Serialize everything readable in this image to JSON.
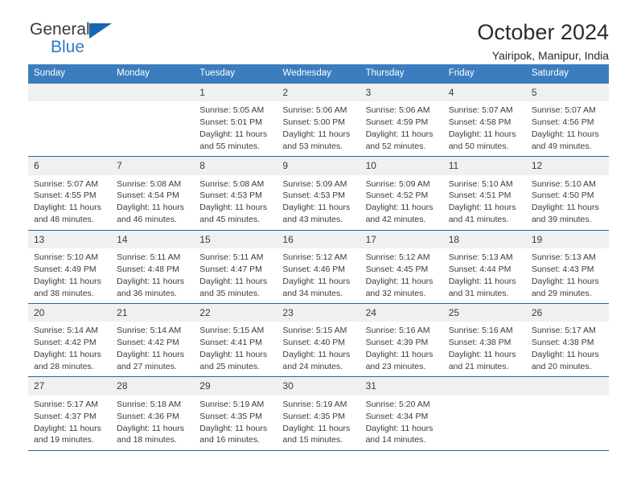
{
  "brand": {
    "name_top": "General",
    "name_bottom": "Blue",
    "triangle_icon": "triangle-icon",
    "accent_color": "#1668b3"
  },
  "header": {
    "title": "October 2024",
    "subtitle": "Yairipok, Manipur, India"
  },
  "calendar": {
    "header_bg": "#3b7dbf",
    "date_band_bg": "#f0f0f0",
    "separator_color": "#1668b3",
    "weekdays": [
      "Sunday",
      "Monday",
      "Tuesday",
      "Wednesday",
      "Thursday",
      "Friday",
      "Saturday"
    ],
    "weeks": [
      [
        {
          "day": "",
          "lines": []
        },
        {
          "day": "",
          "lines": []
        },
        {
          "day": "1",
          "lines": [
            "Sunrise: 5:05 AM",
            "Sunset: 5:01 PM",
            "Daylight: 11 hours",
            "and 55 minutes."
          ]
        },
        {
          "day": "2",
          "lines": [
            "Sunrise: 5:06 AM",
            "Sunset: 5:00 PM",
            "Daylight: 11 hours",
            "and 53 minutes."
          ]
        },
        {
          "day": "3",
          "lines": [
            "Sunrise: 5:06 AM",
            "Sunset: 4:59 PM",
            "Daylight: 11 hours",
            "and 52 minutes."
          ]
        },
        {
          "day": "4",
          "lines": [
            "Sunrise: 5:07 AM",
            "Sunset: 4:58 PM",
            "Daylight: 11 hours",
            "and 50 minutes."
          ]
        },
        {
          "day": "5",
          "lines": [
            "Sunrise: 5:07 AM",
            "Sunset: 4:56 PM",
            "Daylight: 11 hours",
            "and 49 minutes."
          ]
        }
      ],
      [
        {
          "day": "6",
          "lines": [
            "Sunrise: 5:07 AM",
            "Sunset: 4:55 PM",
            "Daylight: 11 hours",
            "and 48 minutes."
          ]
        },
        {
          "day": "7",
          "lines": [
            "Sunrise: 5:08 AM",
            "Sunset: 4:54 PM",
            "Daylight: 11 hours",
            "and 46 minutes."
          ]
        },
        {
          "day": "8",
          "lines": [
            "Sunrise: 5:08 AM",
            "Sunset: 4:53 PM",
            "Daylight: 11 hours",
            "and 45 minutes."
          ]
        },
        {
          "day": "9",
          "lines": [
            "Sunrise: 5:09 AM",
            "Sunset: 4:53 PM",
            "Daylight: 11 hours",
            "and 43 minutes."
          ]
        },
        {
          "day": "10",
          "lines": [
            "Sunrise: 5:09 AM",
            "Sunset: 4:52 PM",
            "Daylight: 11 hours",
            "and 42 minutes."
          ]
        },
        {
          "day": "11",
          "lines": [
            "Sunrise: 5:10 AM",
            "Sunset: 4:51 PM",
            "Daylight: 11 hours",
            "and 41 minutes."
          ]
        },
        {
          "day": "12",
          "lines": [
            "Sunrise: 5:10 AM",
            "Sunset: 4:50 PM",
            "Daylight: 11 hours",
            "and 39 minutes."
          ]
        }
      ],
      [
        {
          "day": "13",
          "lines": [
            "Sunrise: 5:10 AM",
            "Sunset: 4:49 PM",
            "Daylight: 11 hours",
            "and 38 minutes."
          ]
        },
        {
          "day": "14",
          "lines": [
            "Sunrise: 5:11 AM",
            "Sunset: 4:48 PM",
            "Daylight: 11 hours",
            "and 36 minutes."
          ]
        },
        {
          "day": "15",
          "lines": [
            "Sunrise: 5:11 AM",
            "Sunset: 4:47 PM",
            "Daylight: 11 hours",
            "and 35 minutes."
          ]
        },
        {
          "day": "16",
          "lines": [
            "Sunrise: 5:12 AM",
            "Sunset: 4:46 PM",
            "Daylight: 11 hours",
            "and 34 minutes."
          ]
        },
        {
          "day": "17",
          "lines": [
            "Sunrise: 5:12 AM",
            "Sunset: 4:45 PM",
            "Daylight: 11 hours",
            "and 32 minutes."
          ]
        },
        {
          "day": "18",
          "lines": [
            "Sunrise: 5:13 AM",
            "Sunset: 4:44 PM",
            "Daylight: 11 hours",
            "and 31 minutes."
          ]
        },
        {
          "day": "19",
          "lines": [
            "Sunrise: 5:13 AM",
            "Sunset: 4:43 PM",
            "Daylight: 11 hours",
            "and 29 minutes."
          ]
        }
      ],
      [
        {
          "day": "20",
          "lines": [
            "Sunrise: 5:14 AM",
            "Sunset: 4:42 PM",
            "Daylight: 11 hours",
            "and 28 minutes."
          ]
        },
        {
          "day": "21",
          "lines": [
            "Sunrise: 5:14 AM",
            "Sunset: 4:42 PM",
            "Daylight: 11 hours",
            "and 27 minutes."
          ]
        },
        {
          "day": "22",
          "lines": [
            "Sunrise: 5:15 AM",
            "Sunset: 4:41 PM",
            "Daylight: 11 hours",
            "and 25 minutes."
          ]
        },
        {
          "day": "23",
          "lines": [
            "Sunrise: 5:15 AM",
            "Sunset: 4:40 PM",
            "Daylight: 11 hours",
            "and 24 minutes."
          ]
        },
        {
          "day": "24",
          "lines": [
            "Sunrise: 5:16 AM",
            "Sunset: 4:39 PM",
            "Daylight: 11 hours",
            "and 23 minutes."
          ]
        },
        {
          "day": "25",
          "lines": [
            "Sunrise: 5:16 AM",
            "Sunset: 4:38 PM",
            "Daylight: 11 hours",
            "and 21 minutes."
          ]
        },
        {
          "day": "26",
          "lines": [
            "Sunrise: 5:17 AM",
            "Sunset: 4:38 PM",
            "Daylight: 11 hours",
            "and 20 minutes."
          ]
        }
      ],
      [
        {
          "day": "27",
          "lines": [
            "Sunrise: 5:17 AM",
            "Sunset: 4:37 PM",
            "Daylight: 11 hours",
            "and 19 minutes."
          ]
        },
        {
          "day": "28",
          "lines": [
            "Sunrise: 5:18 AM",
            "Sunset: 4:36 PM",
            "Daylight: 11 hours",
            "and 18 minutes."
          ]
        },
        {
          "day": "29",
          "lines": [
            "Sunrise: 5:19 AM",
            "Sunset: 4:35 PM",
            "Daylight: 11 hours",
            "and 16 minutes."
          ]
        },
        {
          "day": "30",
          "lines": [
            "Sunrise: 5:19 AM",
            "Sunset: 4:35 PM",
            "Daylight: 11 hours",
            "and 15 minutes."
          ]
        },
        {
          "day": "31",
          "lines": [
            "Sunrise: 5:20 AM",
            "Sunset: 4:34 PM",
            "Daylight: 11 hours",
            "and 14 minutes."
          ]
        },
        {
          "day": "",
          "lines": []
        },
        {
          "day": "",
          "lines": []
        }
      ]
    ]
  }
}
